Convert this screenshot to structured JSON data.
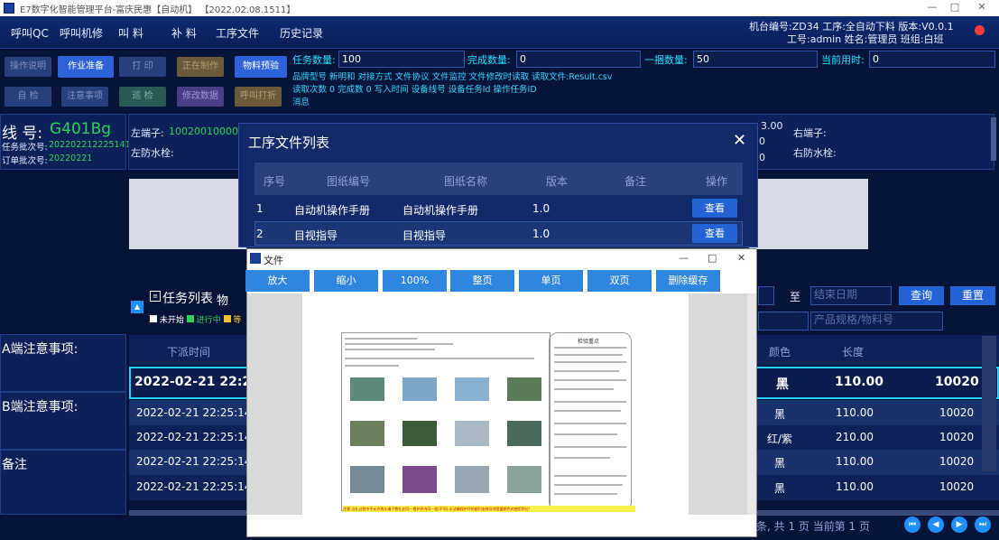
{
  "window": {
    "title": "E7数字化智能管理平台-富庆民惠【自动机】 【2022.02.08.1511】",
    "min": "—",
    "max": "□",
    "close": "✕"
  },
  "nav": [
    "呼叫QC",
    "呼叫机修",
    "叫 料",
    "补 料",
    "工序文件",
    "历史记录"
  ],
  "header_right": {
    "line1": "机台编号:ZD34  工序:全自动下料  版本:V0.0.1",
    "line2": "工号:admin  姓名:管理员  班组:白班"
  },
  "buttons": {
    "row1": [
      "操作说明",
      "作业准备",
      "打 印",
      "正在制作",
      "物料预验"
    ],
    "row2": [
      "自 检",
      "注意事项",
      "巡 检",
      "修改数据",
      "呼叫打折"
    ]
  },
  "fields": {
    "task_qty_label": "任务数量:",
    "task_qty": "100",
    "done_qty_label": "完成数量:",
    "done_qty": "0",
    "bundle_qty_label": "一捆数量:",
    "bundle_qty": "50",
    "elapsed_label": "当前用时:",
    "elapsed": "0"
  },
  "info_lines": [
    "品牌型号 新明和 对接方式 文件协议 文件监控 文件修改时读取 读取文件:Result.csv",
    "读取次数 0 完成数 0 写入时间  设备线号  设备任务Id  操作任务ID",
    "消息"
  ],
  "line_panel": {
    "line_label": "线  号:",
    "line_no": "G401Bg",
    "task_batch_label": "任务批次号:",
    "task_batch": "202202212225141",
    "order_batch_label": "订单批次号:",
    "order_batch": "20220221"
  },
  "mid_panel": {
    "left_terminal_label": "左端子:",
    "left_terminal": "100200100001",
    "left_plug_label": "左防水栓:",
    "val1": "3.00",
    "val2": "0",
    "val3": "0",
    "right_terminal_label": "右端子:",
    "right_plug_label": "右防水栓:"
  },
  "task_list": {
    "title": "任务列表",
    "tab2": "物",
    "legend": [
      "未开始",
      "进行中",
      "等"
    ],
    "search_to": "至",
    "end_date_placeholder": "结束日期",
    "query": "查询",
    "reset": "重置",
    "spec_placeholder": "产品规格/物料号",
    "columns": [
      "下派时间",
      "颜色",
      "长度"
    ],
    "rows": [
      {
        "time": "2022-02-21 22:25",
        "color": "黑",
        "length": "110.00",
        "code": "10020"
      },
      {
        "time": "2022-02-21 22:25:14",
        "color": "黑",
        "length": "110.00",
        "code": "10020"
      },
      {
        "time": "2022-02-21 22:25:14",
        "color": "红/紫",
        "length": "210.00",
        "code": "10020"
      },
      {
        "time": "2022-02-21 22:25:14",
        "color": "黑",
        "length": "110.00",
        "code": "10020"
      },
      {
        "time": "2022-02-21 22:25:14",
        "color": "黑",
        "length": "110.00",
        "code": "10020"
      }
    ],
    "pager": "条, 共 1 页   当前第 1 页"
  },
  "side_labels": {
    "a_notes": "A端注意事项:",
    "b_notes": "B端注意事项:",
    "remarks": "备注"
  },
  "dialog": {
    "title": "工序文件列表",
    "columns": [
      "序号",
      "图纸编号",
      "图纸名称",
      "版本",
      "备注",
      "操作"
    ],
    "rows": [
      {
        "no": "1",
        "code": "自动机操作手册",
        "name": "自动机操作手册",
        "ver": "1.0",
        "note": "",
        "op": "查看"
      },
      {
        "no": "2",
        "code": "目视指导",
        "name": "目视指导",
        "ver": "1.0",
        "note": "",
        "op": "查看"
      }
    ]
  },
  "file_window": {
    "title": "文件",
    "buttons": [
      "放大",
      "缩小",
      "100%",
      "整页",
      "单页",
      "双页",
      "删除缓存"
    ],
    "doc_heading": "检验重点",
    "doc_footer": "注意:当扎过程中不允许两头端子数扎在同一根护环内同一组(不同),无法确保护环的顺利安装导线是要颜色的使用到位!"
  }
}
